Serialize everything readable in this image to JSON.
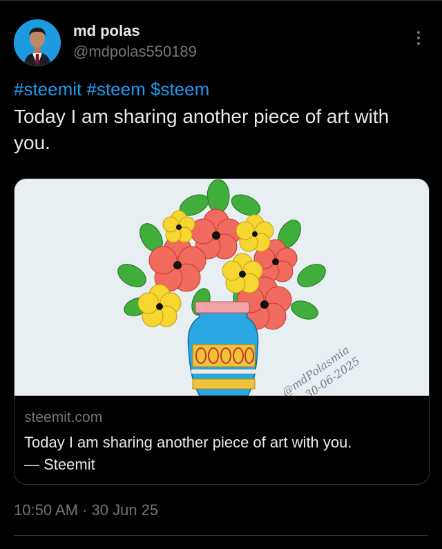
{
  "author": {
    "name": "md polas",
    "handle": "@mdpolas550189"
  },
  "tweet": {
    "hashtags": [
      "#steemit",
      "#steem",
      "$steem"
    ],
    "text": "Today I am sharing another piece of art with you."
  },
  "card": {
    "domain": "steemit.com",
    "title": "Today I am sharing another piece of art with you.",
    "source": "— Steemit",
    "image_signature": "@mdPolasmia",
    "image_date": "30-06-2025"
  },
  "timestamp": {
    "time": "10:50 AM",
    "separator": " · ",
    "date": "30 Jun 25"
  },
  "icons": {
    "more": "more-vertical-icon"
  }
}
